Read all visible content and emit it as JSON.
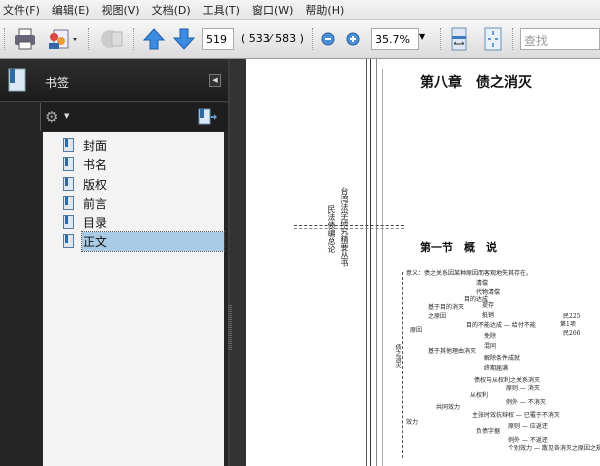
{
  "menu": [
    "文件(F)",
    "编辑(E)",
    "视图(V)",
    "文档(D)",
    "工具(T)",
    "窗口(W)",
    "帮助(H)"
  ],
  "toolbar": {
    "page": "519",
    "page_count": "( 533⁄ 583 )",
    "zoom": "35.7%",
    "search_placeholder": "查找"
  },
  "panel": {
    "title": "书签",
    "bookmarks": [
      "封面",
      "书名",
      "版权",
      "前言",
      "目录",
      "正文"
    ],
    "selected": "正文"
  },
  "document": {
    "chapter_title": "第八章　债之消灭",
    "section_title": "第一节　概　说",
    "series_title": "台湾法学研究精要丛书",
    "book_title": "民法债编总论",
    "diagram": {
      "root": "债之消灭",
      "nodes": [
        "意义：债之关系因某种原因而客观地失其存在。",
        "清偿",
        "代物清偿",
        "目的达成",
        "提存",
        "抵销",
        "目的不能达成 — 给付不能",
        "民225",
        "第1项",
        "民266",
        "基于目的消灭之原因",
        "原因",
        "免除",
        "混同",
        "解除条件成就",
        "终期届满",
        "基于其他理由消灭",
        "效力",
        "债权与从权利之关系消灭",
        "从权利",
        "原则 — 消灭",
        "例外 — 不消灭",
        "共同效力",
        "主张时效抗辩权 — 已罹于不消灭",
        "负债字据",
        "原则 — 应返还",
        "例外 — 不返还",
        "个别效力 — 散见各消灭之原因之规定。"
      ]
    }
  }
}
